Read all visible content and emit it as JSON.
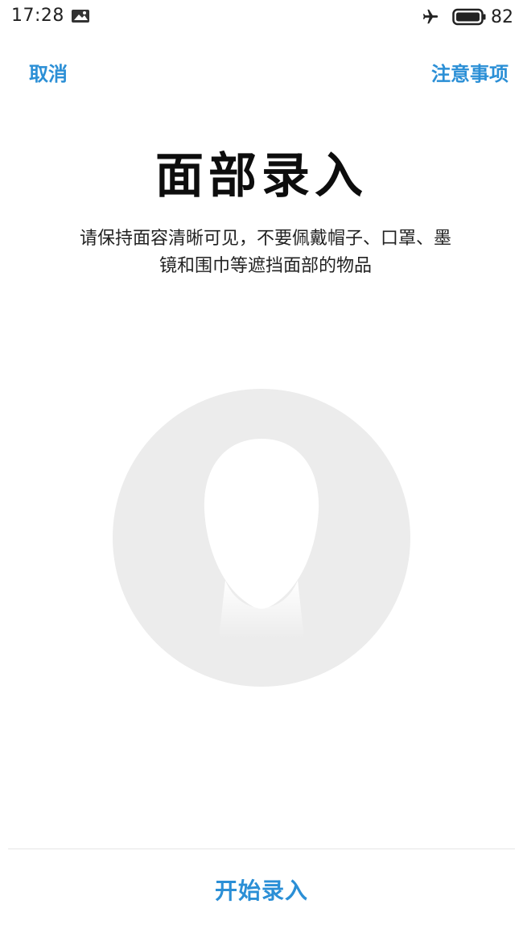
{
  "status_bar": {
    "time": "17:28",
    "battery_level": "82"
  },
  "nav": {
    "cancel_label": "取消",
    "notes_label": "注意事项"
  },
  "main": {
    "title": "面部录入",
    "description": "请保持面容清晰可见，不要佩戴帽子、口罩、墨镜和围巾等遮挡面部的物品"
  },
  "footer": {
    "start_label": "开始录入"
  },
  "colors": {
    "accent": "#2b8fd6",
    "background": "#ffffff",
    "face_circle": "#ececec"
  }
}
